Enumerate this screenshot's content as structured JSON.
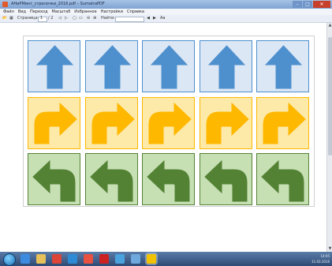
{
  "window": {
    "title": "АНиРМинт_стрелочки_2016.pdf – SumatraPDF",
    "min": "–",
    "max": "□",
    "close": "✕"
  },
  "menu": [
    "Файл",
    "Вид",
    "Переход",
    "Масштаб",
    "Избранное",
    "Настройки",
    "Справка"
  ],
  "toolbar": {
    "page_label": "Страница:",
    "page_value": "1",
    "page_total": "/ 2",
    "find_label": "Найти:"
  },
  "document": {
    "rows": [
      {
        "arrow": "up-arrow",
        "bg": "#dce7f5",
        "fill": "#4e90cd",
        "cells": 5
      },
      {
        "arrow": "turn-right-arrow",
        "bg": "#fde9a8",
        "fill": "#ffb800",
        "cells": 5
      },
      {
        "arrow": "turn-left-arrow",
        "bg": "#c6e0b4",
        "fill": "#548235",
        "cells": 5
      }
    ]
  },
  "taskbar": {
    "apps": [
      {
        "name": "ie-icon",
        "color": "#3d8be0"
      },
      {
        "name": "explorer-icon",
        "color": "#e8c05a"
      },
      {
        "name": "chrome-icon",
        "color": "#db4437"
      },
      {
        "name": "wmp-icon",
        "color": "#2d8bd6"
      },
      {
        "name": "yandex-icon",
        "color": "#e8513f"
      },
      {
        "name": "acrobat-icon",
        "color": "#c22"
      },
      {
        "name": "photo-icon",
        "color": "#4aa3df"
      },
      {
        "name": "doc-icon",
        "color": "#6fa8dc"
      },
      {
        "name": "sumatra-icon",
        "color": "#f2c200"
      }
    ],
    "tray_time": "14:05",
    "tray_date": "11.03.2016"
  }
}
